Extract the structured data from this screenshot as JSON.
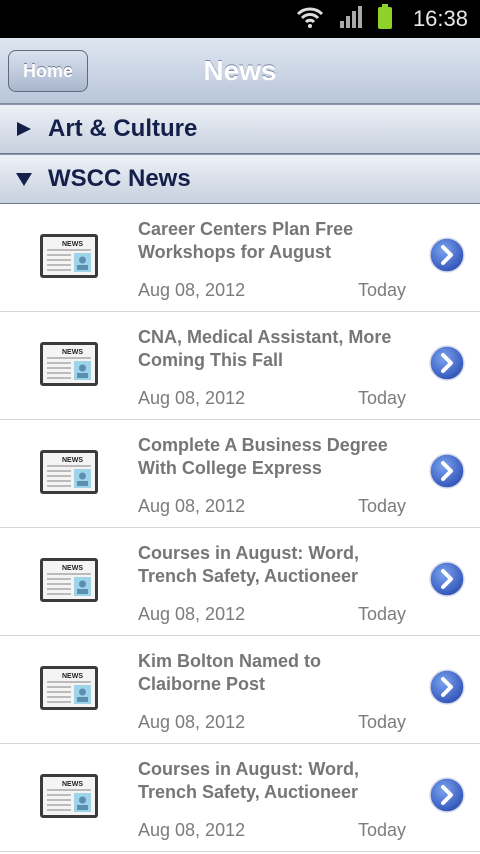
{
  "status_bar": {
    "time": "16:38",
    "icons": [
      "wifi-icon",
      "signal-icon",
      "battery-icon"
    ]
  },
  "nav": {
    "home_label": "Home",
    "title": "News"
  },
  "sections": [
    {
      "label": "Art & Culture",
      "expanded": false
    },
    {
      "label": "WSCC News",
      "expanded": true
    }
  ],
  "news": [
    {
      "title": "Career Centers Plan Free Workshops for August",
      "date": "Aug 08, 2012",
      "when": "Today"
    },
    {
      "title": "CNA, Medical Assistant, More Coming This Fall",
      "date": "Aug 08, 2012",
      "when": "Today"
    },
    {
      "title": "Complete A Business Degree With College Express",
      "date": "Aug 08, 2012",
      "when": "Today"
    },
    {
      "title": "Courses in August: Word, Trench Safety, Auctioneer",
      "date": "Aug 08, 2012",
      "when": "Today"
    },
    {
      "title": "Kim Bolton Named to Claiborne Post",
      "date": "Aug 08, 2012",
      "when": "Today"
    },
    {
      "title": "Courses in August: Word, Trench Safety, Auctioneer",
      "date": "Aug 08, 2012",
      "when": "Today"
    }
  ],
  "thumb_label": "NEWS",
  "colors": {
    "accent": "#14204a",
    "nav_bg": "#b9c6da",
    "chevron": "#3f63c9"
  }
}
